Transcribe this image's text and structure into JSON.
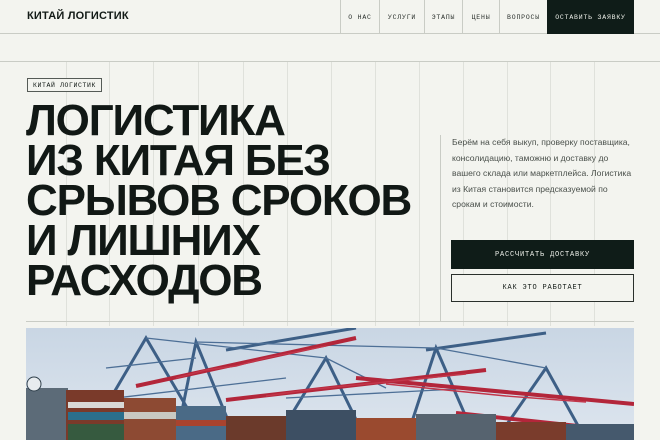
{
  "header": {
    "logo": "КИТАЙ ЛОГИСТИК",
    "nav": [
      "О НАС",
      "УСЛУГИ",
      "ЭТАПЫ",
      "ЦЕНЫ",
      "ВОПРОСЫ"
    ],
    "cta": "ОСТАВИТЬ ЗАЯВКУ"
  },
  "hero": {
    "tag": "КИТАЙ ЛОГИСТИК",
    "title_lines": [
      "ЛОГИСТИКА",
      "ИЗ КИТАЯ БЕЗ",
      "СРЫВОВ СРОКОВ",
      "И ЛИШНИХ",
      "РАСХОДОВ"
    ],
    "description": "Берём на себя выкуп, проверку поставщика, консолидацию, таможню и доставку до вашего склада или маркетплейса. Логистика из Китая становится предсказуемой по срокам и стоимости.",
    "primary_button": "РАССЧИТАТЬ ДОСТАВКУ",
    "secondary_button": "КАК ЭТО РАБОТАЕТ",
    "photo_subject": "port-cranes-and-containers"
  },
  "colors": {
    "background": "#f3f4ef",
    "dark": "#0f1c18",
    "crane_red": "#b3263a",
    "crane_blue": "#3d5f86"
  }
}
